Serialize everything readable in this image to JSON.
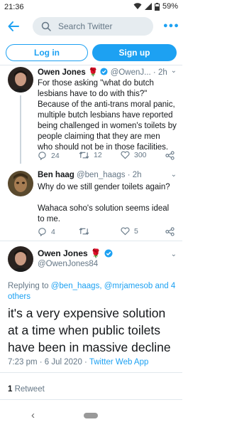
{
  "status_bar": {
    "time": "21:36",
    "battery": "59%"
  },
  "search": {
    "placeholder": "Search Twitter"
  },
  "auth": {
    "login": "Log in",
    "signup": "Sign up"
  },
  "thread": [
    {
      "name": "Owen Jones",
      "rose": "🌹",
      "handle_time": "@OwenJ... · 2h",
      "text": "For those asking \"what do butch lesbians have to do with this?\" Because of the anti-trans moral panic, multiple butch lesbians have reported being challenged in women's toilets by people claiming that they are men who should not be in those facilities.",
      "replies": "24",
      "retweets": "12",
      "likes": "300"
    },
    {
      "name": "Ben haag",
      "handle_time": "@ben_haags · 2h",
      "text": "Why do we still gender toilets again?\n\nWahaca soho's solution seems ideal to me.",
      "replies": "4",
      "retweets": "",
      "likes": "5"
    }
  ],
  "main_tweet": {
    "name": "Owen Jones",
    "rose": "🌹",
    "handle": "@OwenJones84",
    "replying_prefix": "Replying to ",
    "replying_handles": "@ben_haags, @mrjamesob and 4 others",
    "text": "it's a very expensive solution at a time when public toilets have been in massive decline",
    "time": "7:23 pm · 6 Jul 2020 · ",
    "source": "Twitter Web App",
    "retweet_count": "1",
    "retweet_label": " Retweet"
  },
  "colors": {
    "accent": "#1da1f2",
    "muted": "#657786",
    "text": "#14171a",
    "rose": "#e0245e"
  }
}
